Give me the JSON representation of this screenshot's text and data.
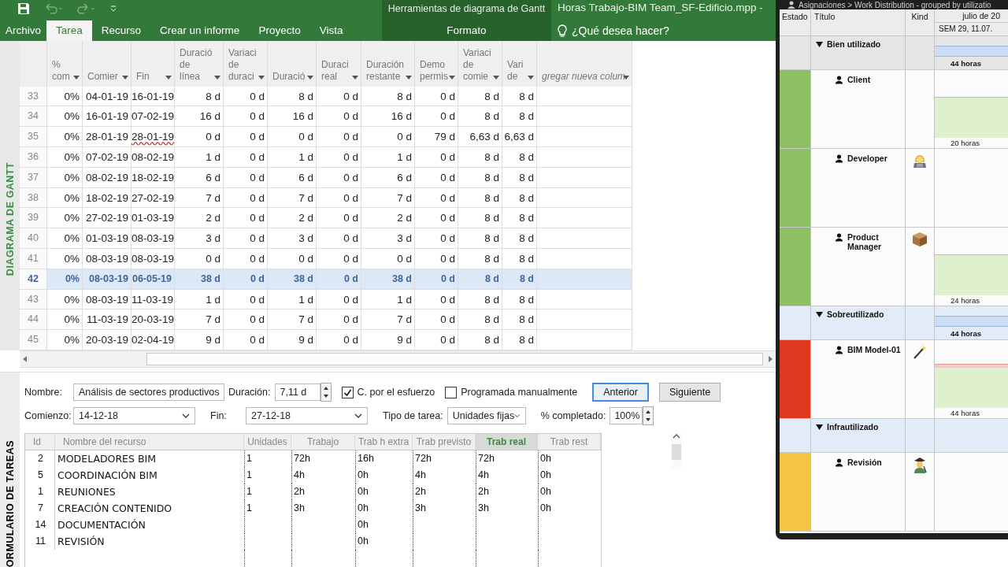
{
  "ribbon": {
    "tabs": [
      {
        "label": "Archivo",
        "selected": false
      },
      {
        "label": "Tarea",
        "selected": true
      },
      {
        "label": "Recurso",
        "selected": false
      },
      {
        "label": "Crear un informe",
        "selected": false
      },
      {
        "label": "Proyecto",
        "selected": false
      },
      {
        "label": "Vista",
        "selected": false
      }
    ],
    "context_group": {
      "label": "Herramientas de diagrama de Gantt",
      "tab": {
        "label": "Formato",
        "selected": false
      }
    },
    "document_title": "Horas Trabajo-BIM Team_SF-Edificio.mpp -",
    "tell_me": "¿Qué desea hacer?"
  },
  "gantt_view": {
    "side_label": "DIAGRAMA DE GANTT",
    "columns": [
      "%\ncom",
      "Comier",
      "Fin",
      "Duració\nde\nlínea",
      "Variaci\nde\nduraci",
      "Duració",
      "Duraci\nreal",
      "Duración\nrestante",
      "Demo\npermis",
      "Variaci\nde\ncomie",
      "Vari\nde",
      "gregar nueva colum"
    ],
    "rows": [
      {
        "id": "33",
        "selected": false,
        "flagged": false,
        "cells": [
          "0%",
          "04-01-19",
          "16-01-19",
          "8 d",
          "0 d",
          "8 d",
          "0 d",
          "8 d",
          "0 d",
          "8 d",
          "8 d"
        ]
      },
      {
        "id": "34",
        "selected": false,
        "flagged": false,
        "cells": [
          "0%",
          "16-01-19",
          "07-02-19",
          "16 d",
          "0 d",
          "16 d",
          "0 d",
          "16 d",
          "0 d",
          "8 d",
          "8 d"
        ]
      },
      {
        "id": "35",
        "selected": false,
        "flagged": true,
        "cells": [
          "0%",
          "28-01-19",
          "28-01-19",
          "0 d",
          "0 d",
          "0 d",
          "0 d",
          "0 d",
          "79 d",
          "6,63 d",
          "6,63 d"
        ]
      },
      {
        "id": "36",
        "selected": false,
        "flagged": false,
        "cells": [
          "0%",
          "07-02-19",
          "08-02-19",
          "1 d",
          "0 d",
          "1 d",
          "0 d",
          "1 d",
          "0 d",
          "8 d",
          "8 d"
        ]
      },
      {
        "id": "37",
        "selected": false,
        "flagged": false,
        "cells": [
          "0%",
          "08-02-19",
          "18-02-19",
          "6 d",
          "0 d",
          "6 d",
          "0 d",
          "6 d",
          "0 d",
          "8 d",
          "8 d"
        ]
      },
      {
        "id": "38",
        "selected": false,
        "flagged": false,
        "cells": [
          "0%",
          "18-02-19",
          "27-02-19",
          "7 d",
          "0 d",
          "7 d",
          "0 d",
          "7 d",
          "0 d",
          "8 d",
          "8 d"
        ]
      },
      {
        "id": "39",
        "selected": false,
        "flagged": false,
        "cells": [
          "0%",
          "27-02-19",
          "01-03-19",
          "2 d",
          "0 d",
          "2 d",
          "0 d",
          "2 d",
          "0 d",
          "8 d",
          "8 d"
        ]
      },
      {
        "id": "40",
        "selected": false,
        "flagged": false,
        "cells": [
          "0%",
          "01-03-19",
          "08-03-19",
          "3 d",
          "0 d",
          "3 d",
          "0 d",
          "3 d",
          "0 d",
          "8 d",
          "8 d"
        ]
      },
      {
        "id": "41",
        "selected": false,
        "flagged": false,
        "cells": [
          "0%",
          "08-03-19",
          "08-03-19",
          "0 d",
          "0 d",
          "0 d",
          "0 d",
          "0 d",
          "0 d",
          "8 d",
          "8 d"
        ]
      },
      {
        "id": "42",
        "selected": true,
        "flagged": false,
        "cells": [
          "0%",
          "08-03-19",
          "06-05-19",
          "38 d",
          "0 d",
          "38 d",
          "0 d",
          "38 d",
          "0 d",
          "8 d",
          "8 d"
        ]
      },
      {
        "id": "43",
        "selected": false,
        "flagged": false,
        "cells": [
          "0%",
          "08-03-19",
          "11-03-19",
          "1 d",
          "0 d",
          "1 d",
          "0 d",
          "1 d",
          "0 d",
          "8 d",
          "8 d"
        ]
      },
      {
        "id": "44",
        "selected": false,
        "flagged": false,
        "cells": [
          "0%",
          "11-03-19",
          "20-03-19",
          "7 d",
          "0 d",
          "7 d",
          "0 d",
          "7 d",
          "0 d",
          "8 d",
          "8 d"
        ]
      },
      {
        "id": "45",
        "selected": false,
        "flagged": false,
        "cells": [
          "0%",
          "20-03-19",
          "02-04-19",
          "9 d",
          "0 d",
          "9 d",
          "0 d",
          "9 d",
          "0 d",
          "8 d",
          "8 d"
        ]
      }
    ]
  },
  "task_form": {
    "side_label": "ORMULARIO DE TAREAS",
    "name_label": "Nombre:",
    "name_value": "Análisis de sectores productivos",
    "duration_label": "Duración:",
    "duration_value": "7,11 d",
    "effort_driven": {
      "label": "C. por el esfuerzo",
      "checked": true
    },
    "manual": {
      "label": "Programada manualmente",
      "checked": false
    },
    "buttons": [
      {
        "label": "Anterior",
        "focused": true
      },
      {
        "label": "Siguiente",
        "focused": false
      }
    ],
    "start_label": "Comienzo:",
    "start_value": "14-12-18",
    "finish_label": "Fin:",
    "finish_value": "27-12-18",
    "type_label": "Tipo de tarea:",
    "type_value": "Unidades fijas",
    "complete_label": "% completado:",
    "complete_value": "100%",
    "resources": {
      "columns": [
        {
          "label": "Id",
          "selected": false
        },
        {
          "label": "Nombre del recurso",
          "selected": false
        },
        {
          "label": "Unidades",
          "selected": false
        },
        {
          "label": "Trabajo",
          "selected": false
        },
        {
          "label": "Trab h extra",
          "selected": false
        },
        {
          "label": "Trab previsto",
          "selected": false
        },
        {
          "label": "Trab real",
          "selected": true
        },
        {
          "label": "Trab rest",
          "selected": false
        }
      ],
      "rows": [
        [
          "2",
          "MODELADORES BIM",
          "1",
          "72h",
          "16h",
          "72h",
          "72h",
          "0h"
        ],
        [
          "5",
          "COORDINACIÓN BIM",
          "1",
          "4h",
          "0h",
          "4h",
          "4h",
          "0h"
        ],
        [
          "1",
          "REUNIONES",
          "1",
          "2h",
          "0h",
          "2h",
          "2h",
          "0h"
        ],
        [
          "7",
          "CREACIÓN CONTENIDO",
          "1",
          "3h",
          "0h",
          "3h",
          "3h",
          "0h"
        ],
        [
          "14",
          "DOCUMENTACIÓN",
          "",
          "",
          "0h",
          "",
          "",
          ""
        ],
        [
          "11",
          "REVISIÓN",
          "",
          "",
          "0h",
          "",
          "",
          ""
        ]
      ]
    }
  },
  "assignments_window": {
    "title": "Asignaciones > Work Distribution - grouped by utilizatio",
    "columns": [
      "Estado",
      "Título",
      "Kind"
    ],
    "month": "julio de 20",
    "week": "SEM 29, 11.07.",
    "groups": [
      {
        "title": "Bien utilizado",
        "expanded": true,
        "selected": true,
        "hours": "44 horas",
        "children": [
          {
            "title": "Client",
            "color": "#8dc063",
            "kind": "plain",
            "bar": true,
            "hours": "20 horas",
            "overbooked": false
          },
          {
            "title": "Developer",
            "color": "#8dc063",
            "kind": "person-laptop",
            "bar": false,
            "overbooked": false
          },
          {
            "title": "Product Manager",
            "color": "#8dc063",
            "kind": "box",
            "bar": true,
            "hours": "24 horas",
            "overbooked": false
          }
        ]
      },
      {
        "title": "Sobreutilizado",
        "expanded": true,
        "selected": false,
        "hours": "44 horas",
        "children": [
          {
            "title": "BIM Model-01",
            "color": "#e0391f",
            "kind": "wand",
            "bar": true,
            "hours": "44 horas",
            "overbooked": true
          }
        ]
      },
      {
        "title": "Infrautilizado",
        "expanded": true,
        "selected": false,
        "children": [
          {
            "title": "Revisión",
            "color": "#f4c542",
            "kind": "person-cap",
            "bar": false,
            "overbooked": false
          }
        ]
      }
    ]
  }
}
